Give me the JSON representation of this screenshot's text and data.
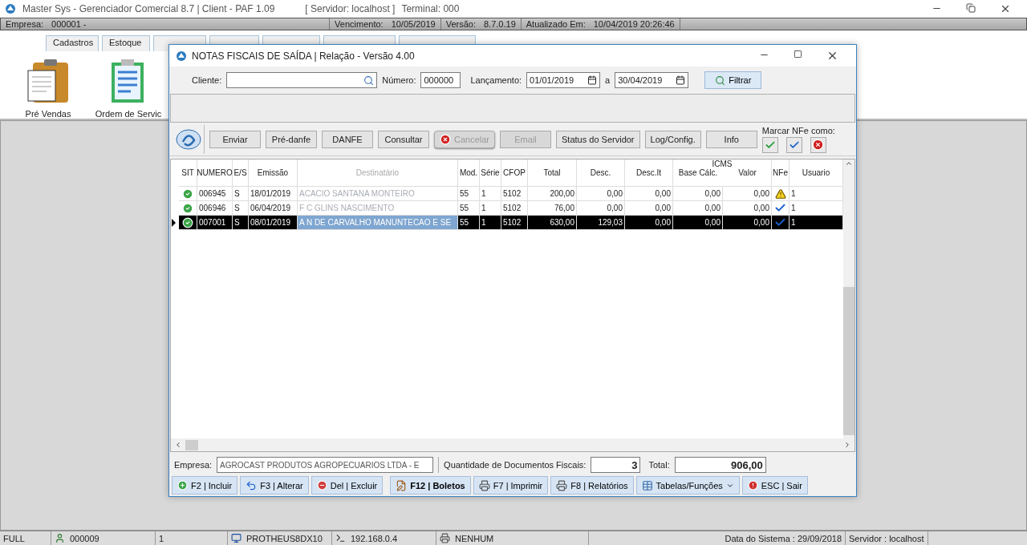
{
  "app": {
    "title": "Master Sys - Gerenciador Comercial 8.7 | Client - PAF 1.09",
    "server": "[ Servidor: localhost ]",
    "terminal": "Terminal: 000"
  },
  "info_bar": [
    {
      "label": "Empresa:",
      "value": "000001 -"
    },
    {
      "label": "Vencimento:",
      "value": "10/05/2019"
    },
    {
      "label": "Versão:",
      "value": "8.7.0.19"
    },
    {
      "label": "Atualizado Em:",
      "value": "10/04/2019 20:26:46"
    }
  ],
  "tabs": [
    {
      "label": "Cadastros"
    },
    {
      "label": "Estoque"
    }
  ],
  "shortcuts": [
    {
      "kind": "clipboard",
      "label": "Pré Vendas"
    },
    {
      "kind": "form",
      "label": "Ordem de Servic"
    }
  ],
  "dialog": {
    "title": "NOTAS FISCAIS DE SAÍDA | Relação  -  Versão 4.00",
    "filter": {
      "client_label": "Cliente:",
      "number_label": "Número:",
      "number": "000000",
      "date_label": "Lançamento:",
      "date_from": "01/01/2019",
      "between": "a",
      "date_to": "30/04/2019",
      "button": "Filtrar"
    },
    "nfe_buttons": [
      {
        "label": "Enviar",
        "kind": "plain",
        "disabled": false
      },
      {
        "label": "Pré-danfe",
        "kind": "plain",
        "disabled": false
      },
      {
        "label": "DANFE",
        "kind": "plain",
        "disabled": false
      },
      {
        "label": "Consultar",
        "kind": "plain",
        "disabled": false
      },
      {
        "label": "Cancelar",
        "kind": "cancel",
        "disabled": true
      },
      {
        "label": "Email",
        "kind": "plain",
        "disabled": true
      },
      {
        "label": "Status do Servidor",
        "kind": "plain",
        "disabled": false
      },
      {
        "label": "Log/Config.",
        "kind": "plain",
        "disabled": false
      },
      {
        "label": "Info",
        "kind": "plain",
        "disabled": false
      }
    ],
    "mark_label": "Marcar NFe como:",
    "mark_buttons": [
      {
        "kind": "ok"
      },
      {
        "kind": "authorized"
      },
      {
        "kind": "cancelled"
      }
    ],
    "table": {
      "columns": [
        "SIT",
        "NUMERO",
        "E/S",
        "Emissão",
        "Destinatário",
        "Mod.",
        "Série",
        "CFOP",
        "Total",
        "Desc.",
        "Desc.It",
        "Base Cálc.",
        "Valor",
        "NFe",
        "Usuario"
      ],
      "group_header": "ICMS",
      "rows": [
        {
          "sit": {
            "kind": "ok"
          },
          "numero": "006945",
          "es": "S",
          "emissao": "18/01/2019",
          "destinatario": "ACACIO SANTANA MONTEIRO",
          "mod": "55",
          "serie": "1",
          "cfop": "5102",
          "total": "200,00",
          "desc": "0,00",
          "desc_it": "0,00",
          "base": "0,00",
          "valor": "0,00",
          "nfe": {
            "kind": "warning"
          },
          "usuario": "1",
          "selected": false
        },
        {
          "sit": {
            "kind": "ok"
          },
          "numero": "006946",
          "es": "S",
          "emissao": "06/04/2019",
          "destinatario": "F C GLINS NASCIMENTO",
          "mod": "55",
          "serie": "1",
          "cfop": "5102",
          "total": "76,00",
          "desc": "0,00",
          "desc_it": "0,00",
          "base": "0,00",
          "valor": "0,00",
          "nfe": {
            "kind": "authorized"
          },
          "usuario": "1",
          "selected": false
        },
        {
          "sit": {
            "kind": "ok"
          },
          "numero": "007001",
          "es": "S",
          "emissao": "08/01/2019",
          "destinatario": "A N DE CARVALHO MANUNTECAO E SE",
          "mod": "55",
          "serie": "1",
          "cfop": "5102",
          "total": "630,00",
          "desc": "129,03",
          "desc_it": "0,00",
          "base": "0,00",
          "valor": "0,00",
          "nfe": {
            "kind": "authorized"
          },
          "usuario": "1",
          "selected": true
        }
      ]
    },
    "footer": {
      "company_label": "Empresa:",
      "company": "AGROCAST PRODUTOS AGROPECUARIOS LTDA - E",
      "count_label": "Quantidade de Documentos Fiscais:",
      "count": "3",
      "total_label": "Total:",
      "total": "906,00"
    },
    "actions": [
      {
        "kind": "add",
        "label": "F2 | Incluir"
      },
      {
        "kind": "edit",
        "label": "F3 | Alterar"
      },
      {
        "kind": "delete",
        "label": "Del | Excluir"
      },
      {
        "kind": "boleto",
        "label": "F12 | Boletos"
      },
      {
        "kind": "print",
        "label": "F7 | Imprimir"
      },
      {
        "kind": "print",
        "label": "F8 | Relatórios"
      },
      {
        "kind": "menu",
        "label": "Tabelas/Funções"
      },
      {
        "kind": "exit",
        "label": "ESC | Sair"
      }
    ]
  },
  "status_bar": [
    {
      "kind": "text",
      "text": "FULL"
    },
    {
      "kind": "user",
      "text": "000009"
    },
    {
      "kind": "text",
      "text": "1"
    },
    {
      "kind": "computer",
      "text": "PROTHEUS8DX10"
    },
    {
      "kind": "terminal",
      "text": "192.168.0.4"
    },
    {
      "kind": "printer",
      "text": "NENHUM"
    },
    {
      "kind": "wide",
      "text": "Data do Sistema : 29/09/2018"
    },
    {
      "kind": "text",
      "text": "Servidor : localhost"
    }
  ]
}
